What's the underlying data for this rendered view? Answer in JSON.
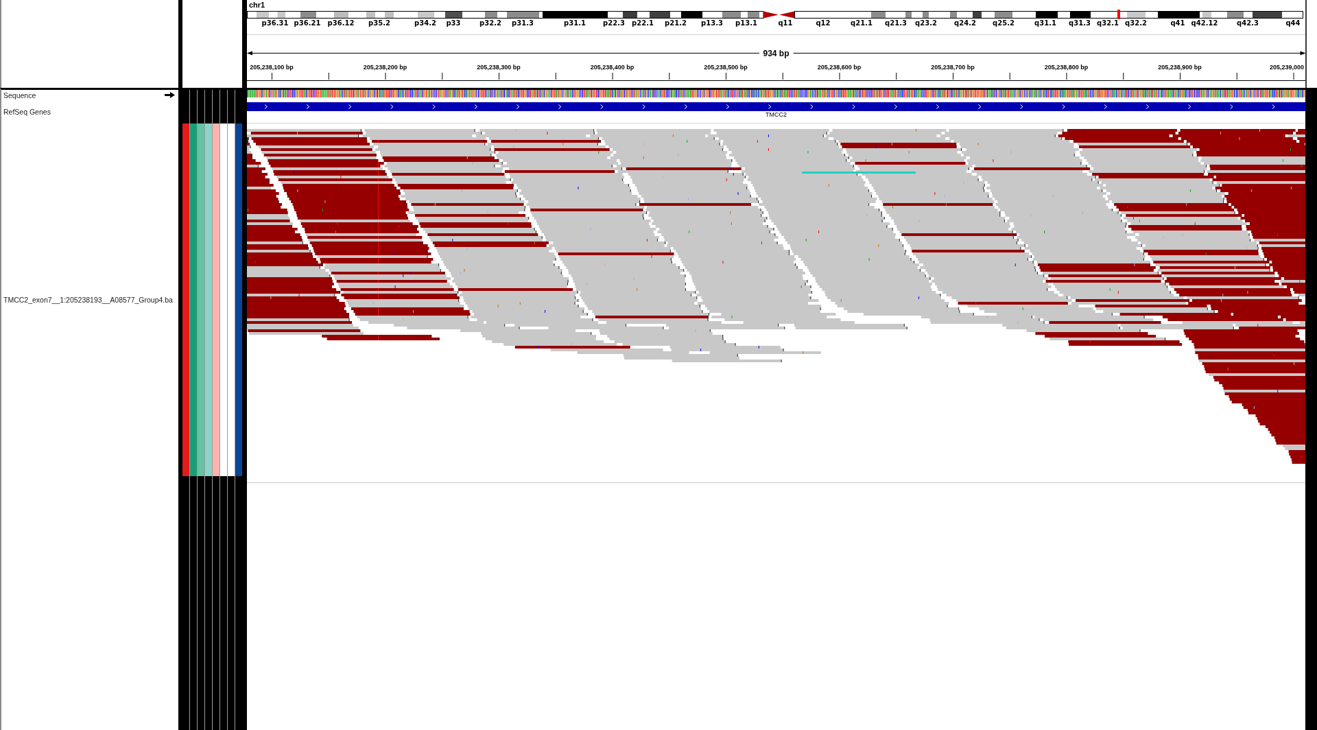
{
  "ideogram": {
    "chromosome": "chr1",
    "band_labels": [
      "p36.31",
      "p36.21",
      "p36.12",
      "p35.2",
      "p34.2",
      "p33",
      "p32.2",
      "p31.3",
      "p31.1",
      "p22.3",
      "p22.1",
      "p21.2",
      "p13.3",
      "p13.1",
      "q11",
      "q12",
      "q21.1",
      "q21.3",
      "q23.2",
      "q24.2",
      "q25.2",
      "q31.1",
      "q31.3",
      "q32.1",
      "q32.2",
      "q41",
      "q42.12",
      "q42.3",
      "q44"
    ]
  },
  "ruler": {
    "span": "934 bp",
    "ticks": [
      "205,238,100 bp",
      "205,238,200 bp",
      "205,238,300 bp",
      "205,238,400 bp",
      "205,238,500 bp",
      "205,238,600 bp",
      "205,238,700 bp",
      "205,238,800 bp",
      "205,238,900 bp",
      "205,239,000"
    ]
  },
  "tracks": [
    {
      "kind": "sequence",
      "name": "Sequence",
      "forward_strand": true
    },
    {
      "kind": "genes",
      "name": "RefSeq Genes",
      "genes": [
        "TMCC2"
      ]
    },
    {
      "kind": "alignments",
      "name": "TMCC2_exon7__1:205238193__A08577_Group4.ba",
      "attributes": [
        {
          "color": "#e41a1c"
        },
        {
          "color": "#1b9e77"
        },
        {
          "color": "#66c2a5"
        },
        {
          "color": "#8dd3c7"
        },
        {
          "color": "#fbb4ae"
        },
        {
          "color": "#ffffff"
        },
        {
          "color": "#ffffff"
        },
        {
          "color": "#0b4595"
        }
      ]
    }
  ]
}
